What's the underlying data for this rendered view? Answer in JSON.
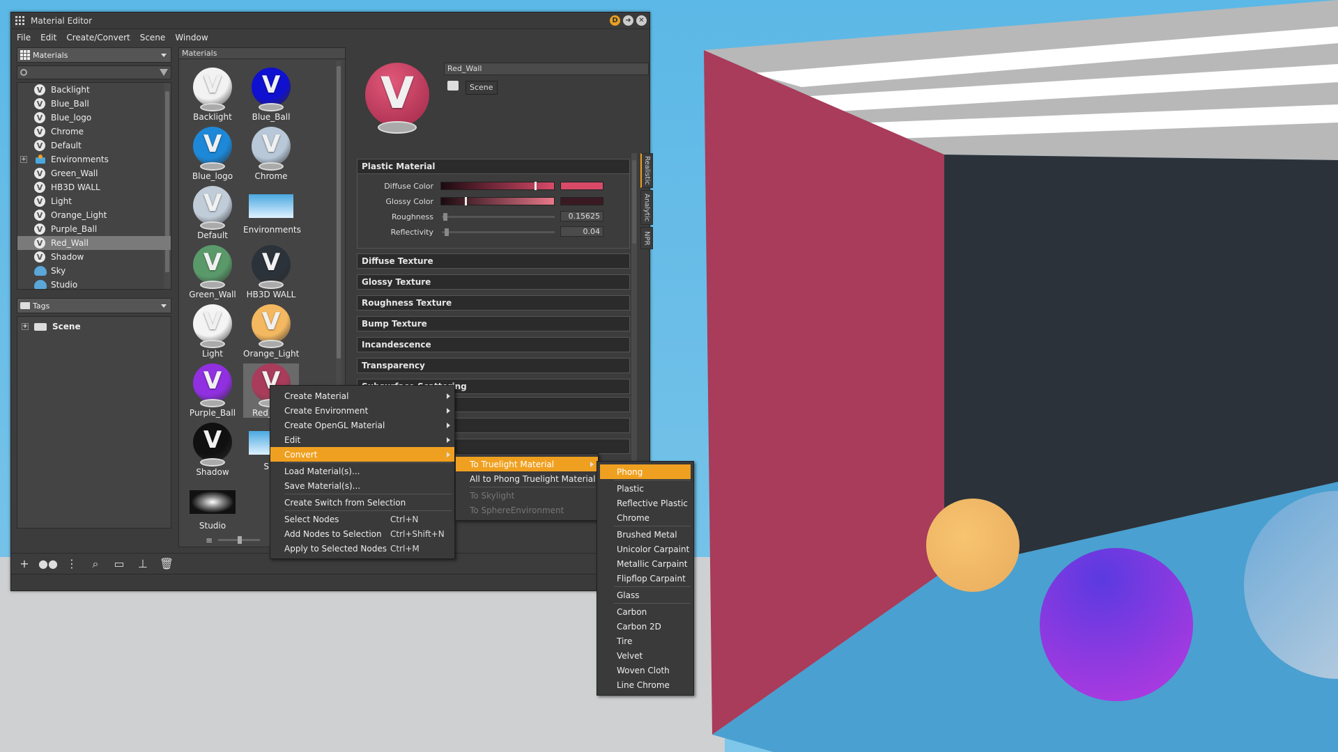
{
  "window": {
    "title": "Material Editor"
  },
  "menubar": [
    "File",
    "Edit",
    "Create/Convert",
    "Scene",
    "Window"
  ],
  "left_panel": {
    "combo_label": "Materials",
    "tree_items": [
      {
        "label": "Backlight",
        "icon": "material-v-icon"
      },
      {
        "label": "Blue_Ball",
        "icon": "material-v-icon"
      },
      {
        "label": "Blue_logo",
        "icon": "material-v-icon"
      },
      {
        "label": "Chrome",
        "icon": "material-v-icon"
      },
      {
        "label": "Default",
        "icon": "material-v-icon"
      },
      {
        "label": "Environments",
        "icon": "environments-icon"
      },
      {
        "label": "Green_Wall",
        "icon": "material-v-icon"
      },
      {
        "label": "HB3D WALL",
        "icon": "material-v-icon"
      },
      {
        "label": "Light",
        "icon": "material-v-icon"
      },
      {
        "label": "Orange_Light",
        "icon": "material-v-icon"
      },
      {
        "label": "Purple_Ball",
        "icon": "material-v-icon"
      },
      {
        "label": "Red_Wall",
        "icon": "material-v-icon",
        "selected": true
      },
      {
        "label": "Shadow",
        "icon": "material-v-icon"
      },
      {
        "label": "Sky",
        "icon": "sky-icon"
      },
      {
        "label": "Studio",
        "icon": "sky-icon"
      }
    ],
    "tags_combo_label": "Tags",
    "tags_tree": [
      {
        "label": "Scene"
      }
    ]
  },
  "thumb_panel": {
    "header": "Materials",
    "items": [
      {
        "label": "Backlight",
        "color": "#f2f2f2"
      },
      {
        "label": "Blue_Ball",
        "color": "#1010d0"
      },
      {
        "label": "Blue_logo",
        "color": "#1e88d8"
      },
      {
        "label": "Chrome",
        "color": "#b8c8d8"
      },
      {
        "label": "Default",
        "color": "#c0ccd8"
      },
      {
        "label": "Environments",
        "color": "env"
      },
      {
        "label": "Green_Wall",
        "color": "#5a9a6a"
      },
      {
        "label": "HB3D WALL",
        "color": "#2b323a"
      },
      {
        "label": "Light",
        "color": "#f4f4f4"
      },
      {
        "label": "Orange_Light",
        "color": "#f4b860"
      },
      {
        "label": "Purple_Ball",
        "color": "#9030e0"
      },
      {
        "label": "Red_Wall",
        "color": "#a83c5a"
      },
      {
        "label": "Shadow",
        "color": "#101010"
      },
      {
        "label": "Sky",
        "color": "env"
      },
      {
        "label": "Studio",
        "color": "studio"
      }
    ]
  },
  "properties": {
    "name_value": "Red_Wall",
    "scene_button": "Scene",
    "plastic_section": "Plastic Material",
    "diffuse_color_label": "Diffuse Color",
    "diffuse_color": "#d84a68",
    "glossy_color_label": "Glossy Color",
    "glossy_color": "#3a1a22",
    "roughness_label": "Roughness",
    "roughness_value": "0.15625",
    "reflectivity_label": "Reflectivity",
    "reflectivity_value": "0.04",
    "sections": [
      "Diffuse Texture",
      "Glossy Texture",
      "Roughness Texture",
      "Bump Texture",
      "Incandescence",
      "Transparency",
      "Subsurface Scattering"
    ],
    "side_tabs": [
      "Realistic",
      "Analytic",
      "NPR"
    ]
  },
  "context_menu": {
    "items": [
      {
        "label": "Create Material",
        "submenu": true
      },
      {
        "label": "Create Environment",
        "submenu": true
      },
      {
        "label": "Create OpenGL Material",
        "submenu": true
      },
      {
        "label": "Edit",
        "submenu": true
      },
      {
        "label": "Convert",
        "submenu": true,
        "highlighted": true
      },
      {
        "label": "Load Material(s)..."
      },
      {
        "label": "Save Material(s)..."
      },
      {
        "label": "Create Switch from Selection"
      },
      {
        "label": "Select Nodes",
        "shortcut": "Ctrl+N"
      },
      {
        "label": "Add Nodes to Selection",
        "shortcut": "Ctrl+Shift+N"
      },
      {
        "label": "Apply to Selected Nodes",
        "shortcut": "Ctrl+M"
      }
    ]
  },
  "convert_menu": {
    "items": [
      {
        "label": "To Truelight Material",
        "submenu": true,
        "highlighted": true
      },
      {
        "label": "All to Phong Truelight Material"
      },
      {
        "label": "To Skylight",
        "disabled": true
      },
      {
        "label": "To SphereEnvironment",
        "disabled": true
      }
    ]
  },
  "truelight_menu": {
    "items": [
      "Phong",
      "Plastic",
      "Reflective Plastic",
      "Chrome",
      "Brushed Metal",
      "Unicolor Carpaint",
      "Metallic Carpaint",
      "Flipflop Carpaint",
      "Glass",
      "Carbon",
      "Carbon 2D",
      "Tire",
      "Velvet",
      "Woven Cloth",
      "Line Chrome"
    ],
    "highlighted": "Phong"
  },
  "colors": {
    "accent": "#f0a020",
    "window_bg": "#3c3c3c",
    "wall_red": "#a83c5a"
  }
}
